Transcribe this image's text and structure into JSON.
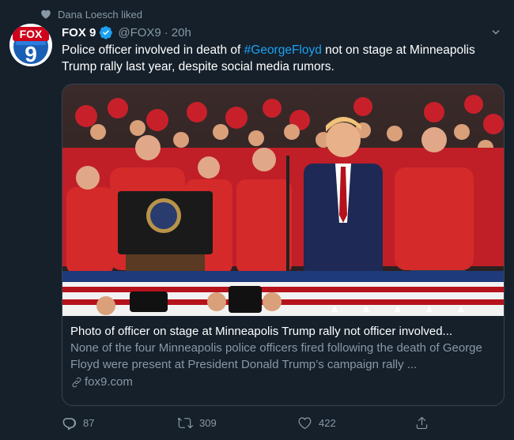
{
  "social_context": {
    "text": "Dana Loesch liked"
  },
  "author": {
    "display_name": "FOX 9",
    "handle": "@FOX9",
    "separator": "·",
    "time": "20h",
    "logo_text_top": "FOX",
    "logo_text_bottom": "9"
  },
  "tweet": {
    "text_before": "Police officer involved in death of ",
    "hashtag": "#GeorgeFloyd",
    "text_after": " not on stage at Minneapolis Trump rally last year, despite social media rumors."
  },
  "card": {
    "image_desc": "rally-stage-photo",
    "title": "Photo of officer on stage at Minneapolis Trump rally not officer involved...",
    "description": "None of the four Minneapolis police officers fired following the death of George Floyd were present at President Donald Trump’s campaign rally ...",
    "domain": "fox9.com"
  },
  "actions": {
    "replies": "87",
    "retweets": "309",
    "likes": "422"
  },
  "colors": {
    "background": "#15202b",
    "accent": "#1da1f2",
    "secondary_text": "#8899a6",
    "border": "#38444d"
  }
}
